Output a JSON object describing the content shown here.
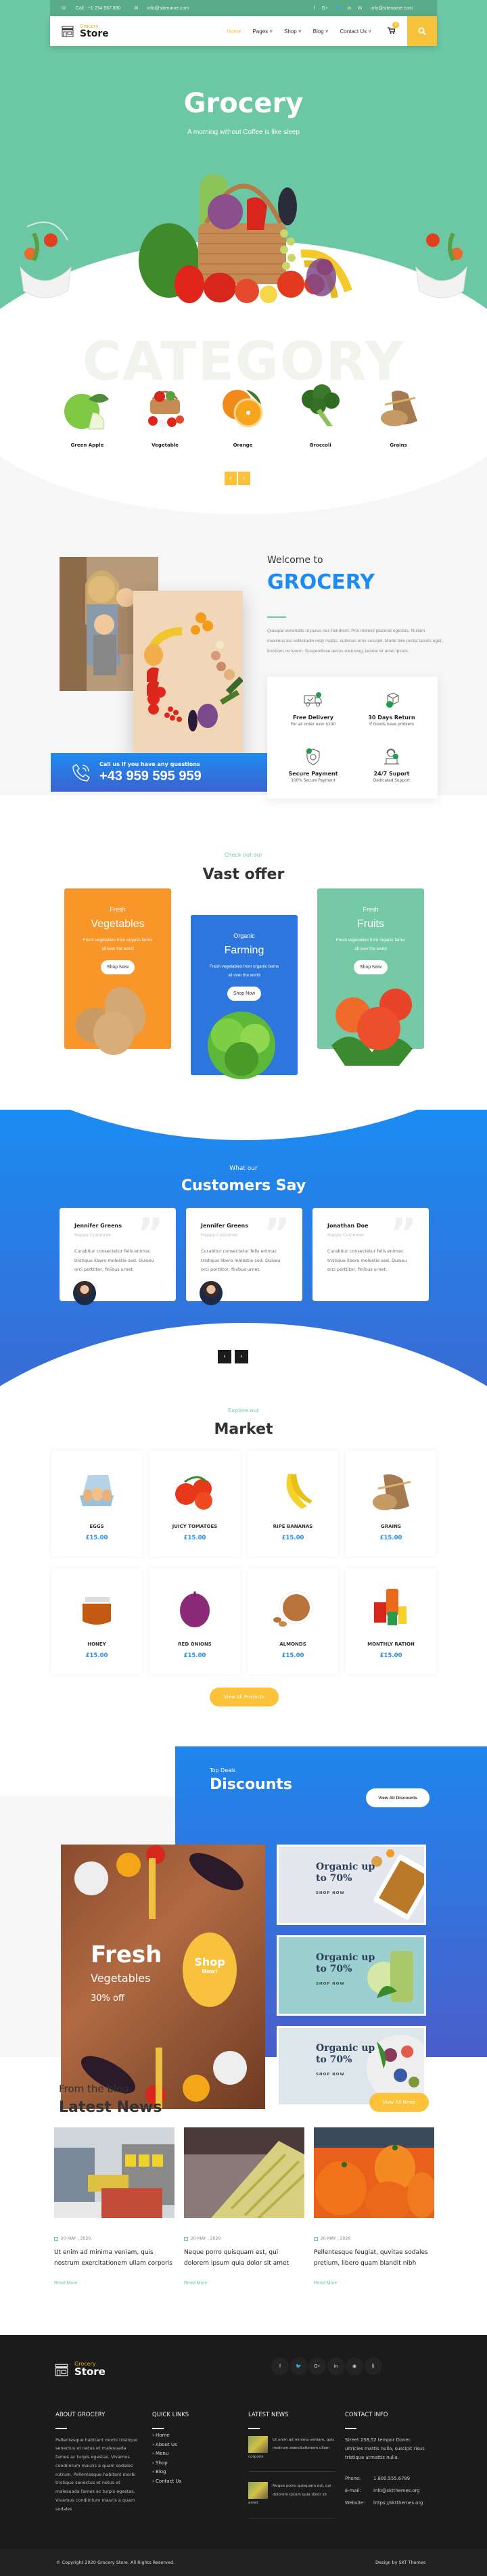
{
  "colors": {
    "primary_green": "#6cc7a4",
    "accent_yellow": "#f7c23b",
    "brand_blue": "#1e8bf0",
    "orange": "#f9962a",
    "footer_dark": "#1b1b1b"
  },
  "topbar": {
    "phone": "Call : +1 234 567 890",
    "email_left": "info@sitename.com",
    "email_right": "info@sitename.com",
    "social": [
      "f",
      "G+",
      "tw",
      "in"
    ]
  },
  "header": {
    "logo_small": "Grocery",
    "logo_big": "Store",
    "menu": [
      {
        "label": "Home",
        "active": true
      },
      {
        "label": "Pages ˅"
      },
      {
        "label": "Shop ˅"
      },
      {
        "label": "Blog ˅"
      },
      {
        "label": "Contact Us ˅"
      }
    ],
    "cart_count": "0",
    "cart_icon": "🛒",
    "search_icon": "⚲"
  },
  "hero": {
    "title": "Grocery",
    "tagline": "A morning without Coffee is like sleep"
  },
  "category": {
    "watermark": "CATEGORY",
    "items": [
      {
        "label": "Green Apple"
      },
      {
        "label": "Vegetable"
      },
      {
        "label": "Orange"
      },
      {
        "label": "Broccoli"
      },
      {
        "label": "Grains"
      }
    ],
    "prev": "‹",
    "next": "›"
  },
  "welcome": {
    "pre": "Welcome to",
    "title": "GROCERY",
    "paragraph": "Quisque venenatis ut purus nec hendrerit. Proi molesti placerat egestas. Nullam maximus leo sollicitudin nisly mattis, eultrices eros suscipit. Morbi felis portat iaculis eget, tincidunt no lorem. Suspendisse lectus metusing, lacinia sit amet ipsum.",
    "features": [
      {
        "title": "Free Delivery",
        "sub": "For all order over $100",
        "icon": "delivery-truck"
      },
      {
        "title": "30 Days Return",
        "sub": "If Goods have problem",
        "icon": "return-box"
      },
      {
        "title": "Secure Payment",
        "sub": "100% Secure Payment",
        "icon": "shield"
      },
      {
        "title": "24/7 Suport",
        "sub": "Dedicated Support",
        "icon": "support-agent"
      }
    ],
    "call_label": "Call us if you have any questions",
    "call_number": "+43 959 595 959"
  },
  "offer": {
    "sub": "Check out our",
    "title": "Vast offer",
    "cards": [
      {
        "top": "Fresh",
        "name": "Vegetables",
        "desc": "Fresh vegetables from organic farms all over the world",
        "button": "Shop Now"
      },
      {
        "top": "Organic",
        "name": "Farming",
        "desc": "Fresh vegetables from organic farms all over the world",
        "button": "Shop Now"
      },
      {
        "top": "Fresh",
        "name": "Fruits",
        "desc": "Fresh vegetables from organic farms all over the world",
        "button": "Shop Now"
      }
    ]
  },
  "testimonials": {
    "sub": "What our",
    "title": "Customers Say",
    "items": [
      {
        "name": "Jennifer Greens",
        "role": "Happy Customer",
        "text": "Curabitur consectetur felis enimac tristique libero molestie sed. Duiseu orci porttitor, finibus urnet."
      },
      {
        "name": "Jennifer Greens",
        "role": "Happy Customer",
        "text": "Curabitur consectetur felis enimac tristique libero molestie sed. Duiseu orci porttitor, finibus urnet."
      },
      {
        "name": "Jonathan Doe",
        "role": "Happy Customer",
        "text": "Curabitur consectetur felis enimac tristique libero molestie sed. Duiseu orci porttitor, finibus urnet."
      }
    ],
    "prev": "‹",
    "next": "›"
  },
  "market": {
    "sub": "Explore our",
    "title": "Market",
    "products": [
      {
        "name": "EGGS",
        "price": "£15.00"
      },
      {
        "name": "JUICY TOMATOES",
        "price": "£15.00"
      },
      {
        "name": "RIPE BANANAS",
        "price": "£15.00"
      },
      {
        "name": "GRAINS",
        "price": "£15.00"
      },
      {
        "name": "HONEY",
        "price": "£15.00"
      },
      {
        "name": "RED ONIONS",
        "price": "£15.00"
      },
      {
        "name": "ALMONDS",
        "price": "£15.00"
      },
      {
        "name": "MONTHLY RATION",
        "price": "£15.00"
      }
    ],
    "view_all": "View All Products"
  },
  "discounts": {
    "sub": "Top Deals",
    "title": "Discounts",
    "view_all": "View All Discounts",
    "big": {
      "line1": "Fresh",
      "line2": "Vegetables",
      "line3": "30% off",
      "circle1": "Shop",
      "circle2": "Now!"
    },
    "banners": [
      {
        "title": "Organic up to 70%",
        "cta": "SHOP NOW"
      },
      {
        "title": "Organic up to 70%",
        "cta": "SHOP NOW"
      },
      {
        "title": "Organic up to 70%",
        "cta": "SHOP NOW"
      }
    ]
  },
  "blog": {
    "sub": "From the blog",
    "title": "Latest News",
    "view_all": "View All News",
    "posts": [
      {
        "date": "20 MAY , 2020",
        "title": "Ut enim ad minima veniam, quis nostrum exercitationem ullam corporis",
        "read_more": "Read More"
      },
      {
        "date": "20 MAY , 2020",
        "title": "Neque porro quisquam est, qui dolorem ipsum quia dolor sit amet",
        "read_more": "Read More"
      },
      {
        "date": "20 MAY , 2020",
        "title": "Pellentesque feugiat, quvitae sodales pretium, libero quam blandit nibh",
        "read_more": "Read More"
      }
    ]
  },
  "footer": {
    "logo_small": "Grocery",
    "logo_big": "Store",
    "social": [
      "f",
      "✉",
      "G+",
      "in",
      "◉",
      "§"
    ],
    "about_title": "ABOUT GROCERY",
    "about_text": "Pellentesque habitant morbi tristique senectus et netus et malesuada fames ac turpis egestas. Vivamus condiintum mauris a quam sodales rutrum. Pellentesque habitant morbi tristique senectus et netus et malesuada fames ac turpis egestas. Vivamus condiintum mauris a quam sodales",
    "links_title": "QUICK LINKS",
    "links": [
      "Home",
      "About Us",
      "Menu",
      "Shop",
      "Blog",
      "Contact Us"
    ],
    "news_title": "LATEST NEWS",
    "news": [
      "Ut enim ad minima veniam, quis nostrum exercitationem ullam corporis",
      "Neque porro quisquam est, qui dolorem ipsum quia dolor sit amet"
    ],
    "contact_title": "CONTACT INFO",
    "address": "Street 238,52 tempor Donec ultricies mattis nulla, suscipit risus tristique utmattis nulla.",
    "phone_label": "Phone:",
    "phone": "1.800.555.6789",
    "email_label": "E-mail:",
    "email": "info@sktthemes.org",
    "website_label": "Website:",
    "website": "https://sktthemes.org",
    "copyright": "© Copyright 2020 Grocery Store. All Rights Reserved.",
    "credit": "Design by SKT Themes"
  }
}
